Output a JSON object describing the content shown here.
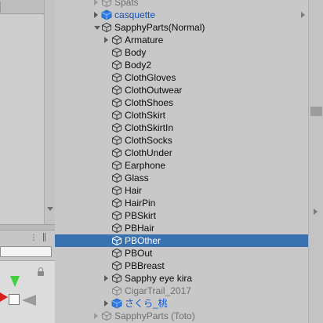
{
  "hierarchy": {
    "items": [
      {
        "label": "Spats",
        "depth": 1,
        "expander": "right",
        "style": "dim",
        "icon": "gameobject-cube-icon"
      },
      {
        "label": "casquette",
        "depth": 1,
        "expander": "right",
        "style": "blue",
        "icon": "prefab-cube-icon",
        "trailing": "chevron-right-icon"
      },
      {
        "label": "SapphyParts(Normal)",
        "depth": 1,
        "expander": "down",
        "style": "normal",
        "icon": "gameobject-cube-icon"
      },
      {
        "label": "Armature",
        "depth": 2,
        "expander": "right",
        "style": "normal",
        "icon": "gameobject-cube-icon"
      },
      {
        "label": "Body",
        "depth": 2,
        "expander": "none",
        "style": "normal",
        "icon": "gameobject-cube-icon"
      },
      {
        "label": "Body2",
        "depth": 2,
        "expander": "none",
        "style": "normal",
        "icon": "gameobject-cube-icon"
      },
      {
        "label": "ClothGloves",
        "depth": 2,
        "expander": "none",
        "style": "normal",
        "icon": "gameobject-cube-icon"
      },
      {
        "label": "ClothOutwear",
        "depth": 2,
        "expander": "none",
        "style": "normal",
        "icon": "gameobject-cube-icon"
      },
      {
        "label": "ClothShoes",
        "depth": 2,
        "expander": "none",
        "style": "normal",
        "icon": "gameobject-cube-icon"
      },
      {
        "label": "ClothSkirt",
        "depth": 2,
        "expander": "none",
        "style": "normal",
        "icon": "gameobject-cube-icon"
      },
      {
        "label": "ClothSkirtIn",
        "depth": 2,
        "expander": "none",
        "style": "normal",
        "icon": "gameobject-cube-icon"
      },
      {
        "label": "ClothSocks",
        "depth": 2,
        "expander": "none",
        "style": "normal",
        "icon": "gameobject-cube-icon"
      },
      {
        "label": "ClothUnder",
        "depth": 2,
        "expander": "none",
        "style": "normal",
        "icon": "gameobject-cube-icon"
      },
      {
        "label": "Earphone",
        "depth": 2,
        "expander": "none",
        "style": "normal",
        "icon": "gameobject-cube-icon"
      },
      {
        "label": "Glass",
        "depth": 2,
        "expander": "none",
        "style": "normal",
        "icon": "gameobject-cube-icon"
      },
      {
        "label": "Hair",
        "depth": 2,
        "expander": "none",
        "style": "normal",
        "icon": "gameobject-cube-icon"
      },
      {
        "label": "HairPin",
        "depth": 2,
        "expander": "none",
        "style": "normal",
        "icon": "gameobject-cube-icon"
      },
      {
        "label": "PBSkirt",
        "depth": 2,
        "expander": "none",
        "style": "normal",
        "icon": "gameobject-cube-icon"
      },
      {
        "label": "PBHair",
        "depth": 2,
        "expander": "none",
        "style": "normal",
        "icon": "gameobject-cube-icon"
      },
      {
        "label": "PBOther",
        "depth": 2,
        "expander": "none",
        "style": "selected",
        "icon": "gameobject-cube-icon"
      },
      {
        "label": "PBOut",
        "depth": 2,
        "expander": "none",
        "style": "normal",
        "icon": "gameobject-cube-icon"
      },
      {
        "label": "PBBreast",
        "depth": 2,
        "expander": "none",
        "style": "normal",
        "icon": "gameobject-cube-icon"
      },
      {
        "label": "Sapphy eye kira",
        "depth": 2,
        "expander": "right",
        "style": "normal",
        "icon": "gameobject-cube-icon"
      },
      {
        "label": "CigarTrail_2017",
        "depth": 2,
        "expander": "none",
        "style": "dim",
        "icon": "gameobject-cube-icon"
      },
      {
        "label": "さくら_桃",
        "depth": 2,
        "expander": "right",
        "style": "blue2",
        "icon": "prefab-cube-icon"
      },
      {
        "label": "SapphyParts (Toto)",
        "depth": 1,
        "expander": "right",
        "style": "dim",
        "icon": "gameobject-cube-icon"
      }
    ]
  },
  "colors": {
    "selection": "#3a72b0",
    "prefab_blue": "#0f4fb8",
    "disabled_gray": "#6f6f6f",
    "panel_bg": "#c8c8c8"
  }
}
